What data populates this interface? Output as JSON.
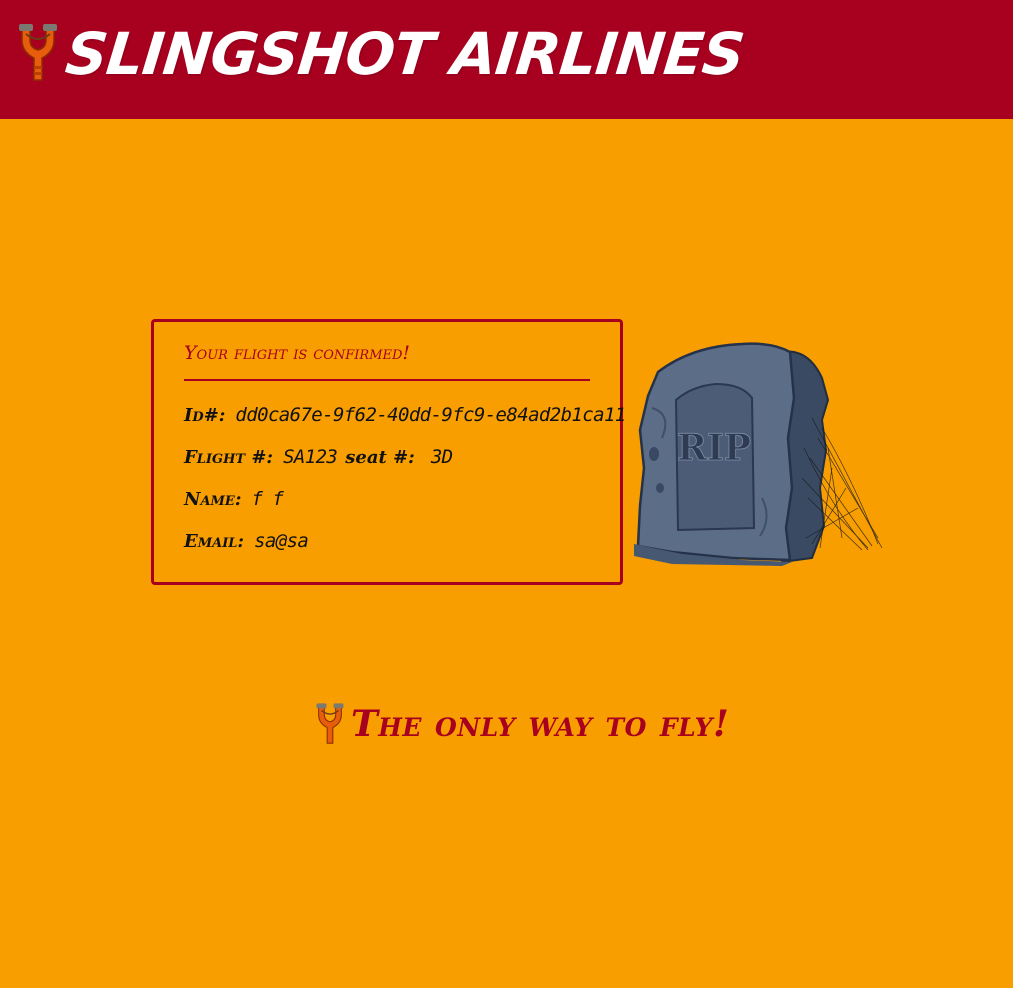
{
  "header": {
    "brand": "Slingshot Airlines",
    "logo_icon": "slingshot-icon"
  },
  "confirmation": {
    "title": "Your flight is confirmed!",
    "id_label": "Id#:",
    "id_value": "dd0ca67e-9f62-40dd-9fc9-e84ad2b1ca11",
    "flight_label": "Flight #:",
    "flight_value": "SA123",
    "seat_label": "seat #:",
    "seat_value": "3D",
    "name_label": "Name:",
    "name_first": "f",
    "name_last": "f",
    "email_label": "Email:",
    "email_value": "sa@sa"
  },
  "graphic": {
    "tombstone_text": "RIP",
    "icon": "tombstone-icon"
  },
  "footer": {
    "slogan": "The only way to fly!",
    "logo_icon": "slingshot-icon"
  },
  "colors": {
    "background": "#f89e00",
    "brand_red": "#a8001f",
    "text": "#111111",
    "white": "#ffffff"
  }
}
